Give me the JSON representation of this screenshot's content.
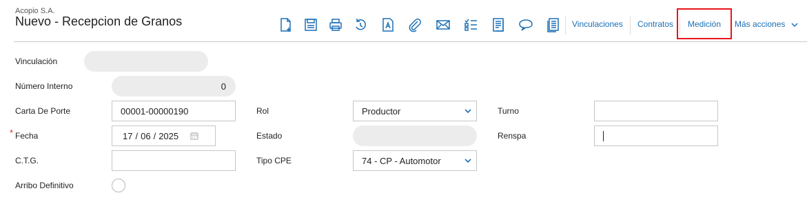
{
  "header": {
    "company": "Acopio S.A.",
    "title": "Nuevo - Recepcion de Granos"
  },
  "toolbar": {
    "icons": [
      "new-document-icon",
      "save-icon",
      "print-icon",
      "undo-icon",
      "text-icon",
      "attachment-icon",
      "mail-icon",
      "checklist-icon",
      "report-icon",
      "comment-icon",
      "notes-icon"
    ],
    "links": {
      "vinculaciones": "Vinculaciones",
      "contratos": "Contratos",
      "medicion": "Medición",
      "mas_acciones": "Más acciones"
    },
    "accent_color": "#1a6fb5",
    "highlight_color": "#e8141a"
  },
  "form": {
    "vinculacion": {
      "label": "Vinculación",
      "value": ""
    },
    "numero_interno": {
      "label": "Número Interno",
      "value": "0"
    },
    "carta_de_porte": {
      "label": "Carta De Porte",
      "value": "00001-00000190"
    },
    "fecha": {
      "label": "Fecha",
      "required_mark": "*",
      "day": "17",
      "month": "06",
      "year": "2025"
    },
    "ctg": {
      "label": "C.T.G.",
      "value": ""
    },
    "arribo_definitivo": {
      "label": "Arribo Definitivo",
      "checked": false
    },
    "rol": {
      "label": "Rol",
      "value": "Productor"
    },
    "estado": {
      "label": "Estado",
      "value": ""
    },
    "tipo_cpe": {
      "label": "Tipo CPE",
      "value": "74 - CP - Automotor"
    },
    "turno": {
      "label": "Turno",
      "value": ""
    },
    "renspa": {
      "label": "Renspa",
      "value": ""
    }
  }
}
